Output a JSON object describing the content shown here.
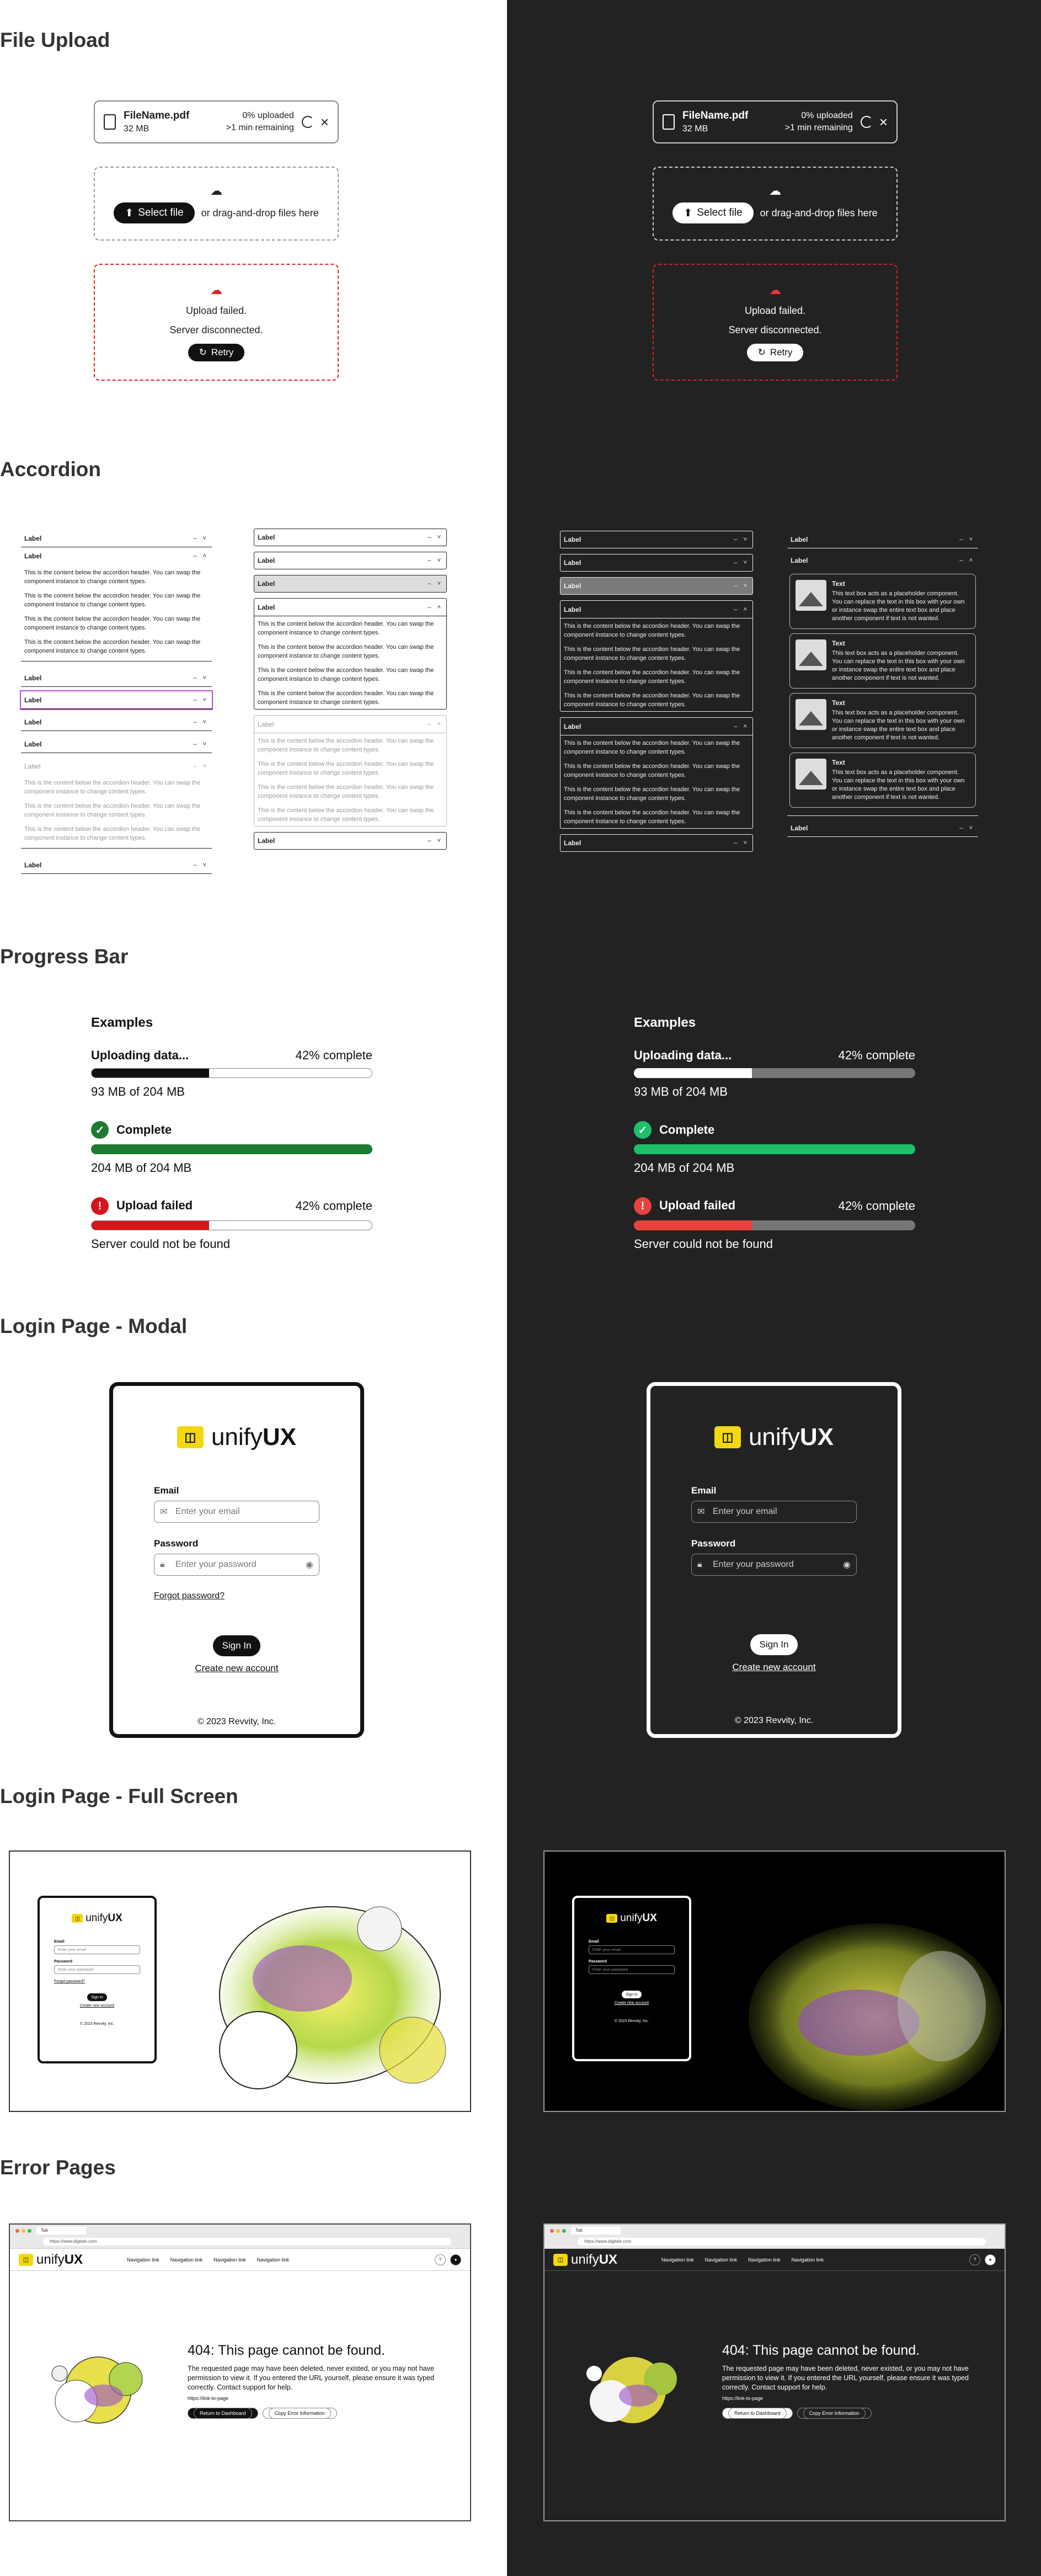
{
  "sections": {
    "file_upload": "File Upload",
    "accordion": "Accordion",
    "progress_bar": "Progress Bar",
    "login_modal": "Login Page - Modal",
    "login_full": "Login Page - Full Screen",
    "error_pages": "Error Pages"
  },
  "file_upload": {
    "file_name": "FileName.pdf",
    "file_size": "32 MB",
    "progress": "0% uploaded",
    "remaining": ">1 min remaining",
    "select_button": "Select file",
    "drag_text": "or drag-and-drop files here",
    "fail_title": "Upload failed.",
    "fail_reason": "Server disconnected.",
    "retry_button": "Retry"
  },
  "accordion": {
    "label": "Label",
    "content": "This is the content below the accordion header. You can swap the component instance to change content types.",
    "card_title": "Text",
    "card_text": "This text box acts as a placeholder component. You can replace the text in this box with your own or instance swap the entire text box and place another component if text is not wanted."
  },
  "progress_bar": {
    "heading": "Examples",
    "uploading_label": "Uploading data...",
    "uploading_pct": "42% complete",
    "uploading_value": 0.42,
    "uploading_size": "93 MB of 204 MB",
    "complete_label": "Complete",
    "complete_value": 1.0,
    "complete_size": "204 MB of 204 MB",
    "failed_label": "Upload failed",
    "failed_pct": "42% complete",
    "failed_value": 0.42,
    "failed_msg": "Server could not be found",
    "colors": {
      "black": "#111111",
      "white": "#ffffff",
      "green_light": "#1f7a32",
      "green_dark": "#1cc16a",
      "red_light": "#d8141b",
      "red_dark": "#e8423f"
    }
  },
  "login": {
    "brand_prefix": "unify",
    "brand_suffix": "UX",
    "email_label": "Email",
    "email_placeholder": "Enter your email",
    "password_label": "Password",
    "password_placeholder": "Enter your password",
    "forgot": "Forgot password?",
    "sign_in": "Sign In",
    "create": "Create new account",
    "copyright": "© 2023 Revvity, Inc."
  },
  "error_page": {
    "tab": "Tab",
    "url": "https://www.digitalx.com",
    "nav_item": "Navigation link",
    "title": "404: This page cannot be found.",
    "body": "The requested page may have been deleted, never existed, or you may not have permission to view it. If you entered the URL yourself, please ensure it was typed correctly. Contact support for help.",
    "link": "https://link-to-page",
    "btn_dashboard": "Return to Dashboard",
    "btn_copy": "Copy Error Information"
  }
}
